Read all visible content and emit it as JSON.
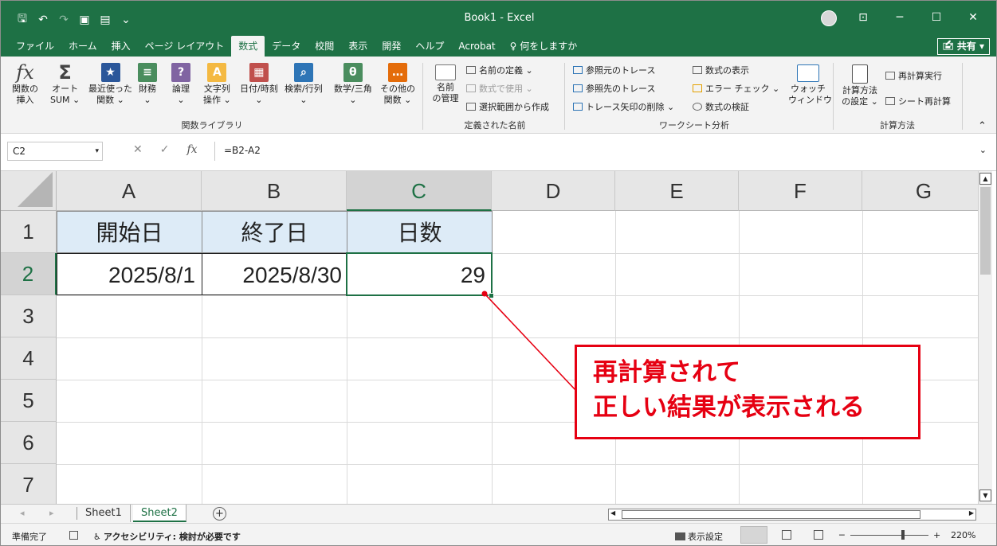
{
  "window": {
    "title": "Book1  -  Excel"
  },
  "qat": {
    "save": "🖫",
    "undo": "↶",
    "redo": "↷",
    "icon1": "▣",
    "icon2": "▤",
    "more": "⌄"
  },
  "winbtns": {
    "ribbon_display": "⊡",
    "minimize": "─",
    "maximize": "☐",
    "close": "✕"
  },
  "tabs": [
    "ファイル",
    "ホーム",
    "挿入",
    "ページ レイアウト",
    "数式",
    "データ",
    "校閲",
    "表示",
    "開発",
    "ヘルプ",
    "Acrobat",
    "♀  何をしますか"
  ],
  "share_label": "🖆 共有 ▾",
  "ribbon": {
    "function_library": {
      "label": "関数ライブラリ",
      "buttons": [
        {
          "label1": "関数の",
          "label2": "挿入",
          "icon": "fx-icon",
          "color": "#444444",
          "glyph": "fx"
        },
        {
          "label1": "オート",
          "label2": "SUM ⌄",
          "icon": "sigma-icon",
          "color": "#444444",
          "glyph": "Σ"
        },
        {
          "label1": "最近使った",
          "label2": "関数 ⌄",
          "icon": "star-icon",
          "color": "#2b579a",
          "glyph": "★"
        },
        {
          "label1": "財務",
          "label2": "⌄",
          "icon": "finance-icon",
          "color": "#4a8d5e",
          "glyph": "≡"
        },
        {
          "label1": "論理",
          "label2": "⌄",
          "icon": "logic-icon",
          "color": "#8064a2",
          "glyph": "?"
        },
        {
          "label1": "文字列",
          "label2": "操作 ⌄",
          "icon": "text-icon",
          "color": "#f4b942",
          "glyph": "A"
        },
        {
          "label1": "日付/時刻",
          "label2": "⌄",
          "icon": "date-icon",
          "color": "#c0504d",
          "glyph": "▦"
        },
        {
          "label1": "検索/行列",
          "label2": "⌄",
          "icon": "lookup-icon",
          "color": "#2e75b6",
          "glyph": "⌕"
        },
        {
          "label1": "数学/三角",
          "label2": "⌄",
          "icon": "math-icon",
          "color": "#4a8d5e",
          "glyph": "θ"
        },
        {
          "label1": "その他の",
          "label2": "関数 ⌄",
          "icon": "more-functions-icon",
          "color": "#e46c0a",
          "glyph": "…"
        }
      ]
    },
    "defined_names": {
      "label": "定義された名前",
      "manager1": "名前",
      "manager2": "の管理",
      "define": "名前の定義  ⌄",
      "use_in_formula": "数式で使用 ⌄",
      "create_from_selection": "選択範囲から作成"
    },
    "formula_auditing": {
      "label": "ワークシート分析",
      "trace_precedents": "参照元のトレース",
      "trace_dependents": "参照先のトレース",
      "remove_arrows": "トレース矢印の削除  ⌄",
      "show_formulas": "数式の表示",
      "error_checking": "エラー チェック  ⌄",
      "evaluate_formula": "数式の検証",
      "watch1": "ウォッチ",
      "watch2": "ウィンドウ"
    },
    "calculation": {
      "label": "計算方法",
      "options1": "計算方法",
      "options2": "の設定 ⌄",
      "calc_now": "再計算実行",
      "calc_sheet": "シート再計算"
    },
    "collapse": "⌃"
  },
  "formula_bar": {
    "name_box": "C2",
    "name_dd": "▾",
    "cancel": "✕",
    "enter": "✓",
    "fx": "fx",
    "formula": "=B2-A2",
    "expand": "⌄"
  },
  "columns": [
    "A",
    "B",
    "C",
    "D",
    "E",
    "F",
    "G"
  ],
  "rows": [
    "1",
    "2",
    "3",
    "4",
    "5",
    "6",
    "7"
  ],
  "cells": {
    "A1": "開始日",
    "B1": "終了日",
    "C1": "日数",
    "A2": "2025/8/1",
    "B2": "2025/8/30",
    "C2": "29"
  },
  "sheets": {
    "nav": "◂ ▸",
    "tabs": [
      "Sheet1",
      "Sheet2"
    ],
    "add": "+"
  },
  "status": {
    "ready": "準備完了",
    "accessibility": "アクセシビリティ: 検討が必要です",
    "display_settings": "表示設定",
    "zoom": "220%",
    "zoom_minus": "─",
    "zoom_plus": "+"
  },
  "callout": {
    "line1": "再計算されて",
    "line2": "正しい結果が表示される",
    "color": "#e60012"
  },
  "colors": {
    "excel_green": "#1e7145",
    "header_fill": "#ddebf7"
  }
}
